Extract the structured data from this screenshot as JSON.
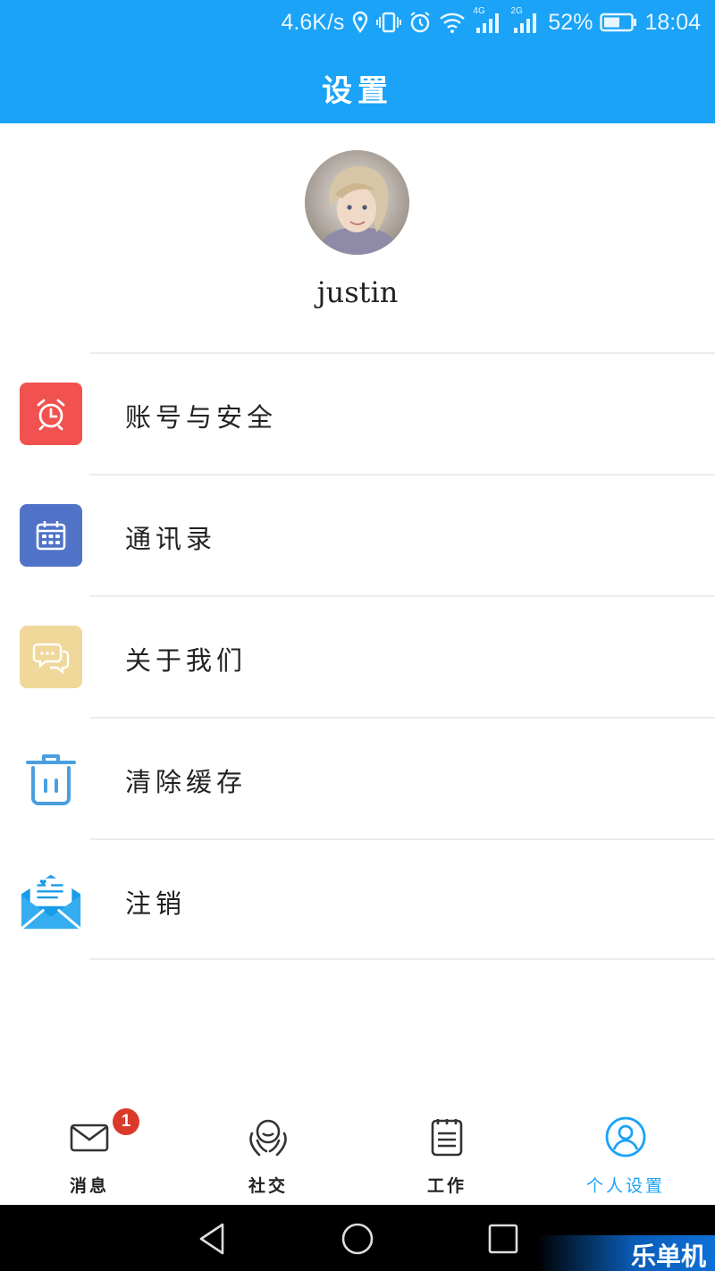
{
  "status_bar": {
    "net_speed": "4.6K/s",
    "battery_percent": "52%",
    "time": "18:04",
    "net_4g_label": "4G",
    "net_2g_label": "2G",
    "icons": [
      "location-icon",
      "vibrate-icon",
      "alarm-icon",
      "wifi-icon",
      "signal-4g-icon",
      "signal-2g-icon",
      "battery-icon"
    ]
  },
  "header": {
    "title": "设置"
  },
  "profile": {
    "username": "justin"
  },
  "menu": {
    "items": [
      {
        "label": "账号与安全",
        "icon": "alarm-clock-icon",
        "color": "#f1514f"
      },
      {
        "label": "通讯录",
        "icon": "calendar-icon",
        "color": "#5073c8"
      },
      {
        "label": "关于我们",
        "icon": "chat-bubbles-icon",
        "color": "#f0d89a"
      },
      {
        "label": "清除缓存",
        "icon": "trash-icon",
        "color": "#4a9fe0"
      },
      {
        "label": "注销",
        "icon": "envelope-icon",
        "color": "#1a9be8"
      }
    ]
  },
  "tabs": [
    {
      "label": "消息",
      "icon": "mail-icon",
      "badge": "1"
    },
    {
      "label": "社交",
      "icon": "social-icon"
    },
    {
      "label": "工作",
      "icon": "notepad-icon"
    },
    {
      "label": "个人设置",
      "icon": "user-circle-icon",
      "active": true
    }
  ],
  "watermark": {
    "text": "乐单机"
  },
  "colors": {
    "accent": "#1aa3f7",
    "badge": "#d93b2b"
  }
}
